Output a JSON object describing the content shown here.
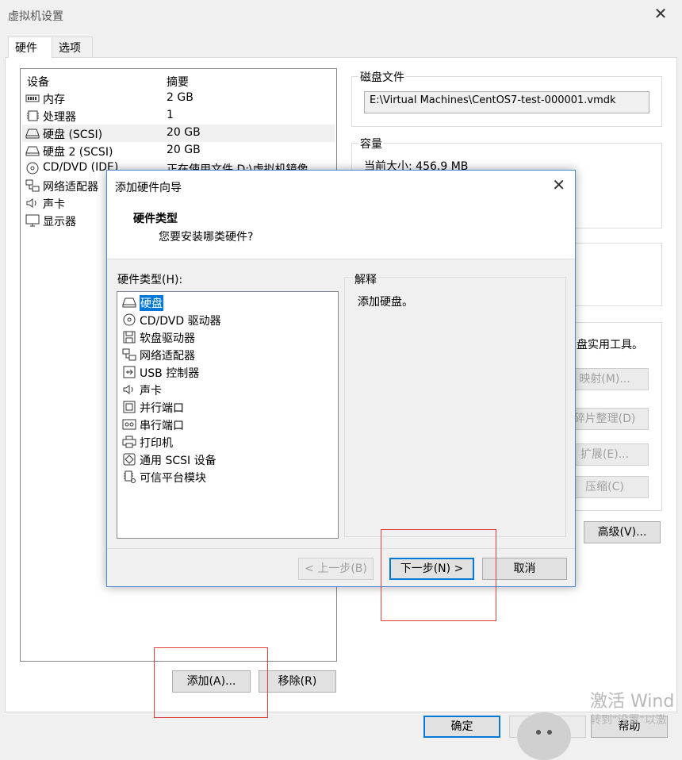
{
  "window": {
    "title": "虚拟机设置",
    "close": "✕"
  },
  "tabs": [
    {
      "label": "硬件"
    },
    {
      "label": "选项"
    }
  ],
  "device_list": {
    "headers": {
      "device": "设备",
      "summary": "摘要"
    },
    "rows": [
      {
        "name": "内存",
        "summary": "2 GB",
        "icon": "memory-icon"
      },
      {
        "name": "处理器",
        "summary": "1",
        "icon": "cpu-icon"
      },
      {
        "name": "硬盘 (SCSI)",
        "summary": "20 GB",
        "icon": "hard-disk-icon"
      },
      {
        "name": "硬盘 2 (SCSI)",
        "summary": "20 GB",
        "icon": "hard-disk-icon"
      },
      {
        "name": "CD/DVD (IDE)",
        "summary": "正在使用文件 D:\\虚拟机镜像",
        "icon": "cd-dvd-icon"
      },
      {
        "name": "网络适配器",
        "summary": "",
        "icon": "network-adapter-icon"
      },
      {
        "name": "声卡",
        "summary": "",
        "icon": "sound-card-icon"
      },
      {
        "name": "显示器",
        "summary": "",
        "icon": "display-icon"
      }
    ]
  },
  "buttons": {
    "add": "添加(A)...",
    "remove": "移除(R)",
    "ok": "确定",
    "help": "帮助",
    "advanced": "高级(V)...",
    "map": "映射(M)...",
    "defrag": "碎片整理(D)",
    "expand": "扩展(E)...",
    "compact": "压缩(C)"
  },
  "disk_file": {
    "label": "磁盘文件",
    "value": "E:\\Virtual Machines\\CentOS7-test-000001.vmdk"
  },
  "capacity": {
    "label": "容量",
    "current_size": "当前大小: 456.9 MB"
  },
  "disk_utilities": {
    "text": "盘实用工具。"
  },
  "wizard": {
    "title": "添加硬件向导",
    "close": "✕",
    "header_title": "硬件类型",
    "header_subtitle": "您要安装哪类硬件?",
    "list_label": "硬件类型(H):",
    "items": [
      {
        "name": "硬盘",
        "icon": "hard-disk-icon"
      },
      {
        "name": "CD/DVD 驱动器",
        "icon": "cd-dvd-icon"
      },
      {
        "name": "软盘驱动器",
        "icon": "floppy-icon"
      },
      {
        "name": "网络适配器",
        "icon": "network-adapter-icon"
      },
      {
        "name": "USB 控制器",
        "icon": "usb-icon"
      },
      {
        "name": "声卡",
        "icon": "sound-card-icon"
      },
      {
        "name": "并行端口",
        "icon": "parallel-port-icon"
      },
      {
        "name": "串行端口",
        "icon": "serial-port-icon"
      },
      {
        "name": "打印机",
        "icon": "printer-icon"
      },
      {
        "name": "通用 SCSI 设备",
        "icon": "scsi-device-icon"
      },
      {
        "name": "可信平台模块",
        "icon": "tpm-icon"
      }
    ],
    "explanation_label": "解释",
    "explanation_text": "添加硬盘。",
    "back": "< 上一步(B)",
    "next": "下一步(N) >",
    "cancel": "取消"
  },
  "watermark": {
    "line1": "激活 Wind",
    "line2": "转到\"设置\"以激"
  }
}
